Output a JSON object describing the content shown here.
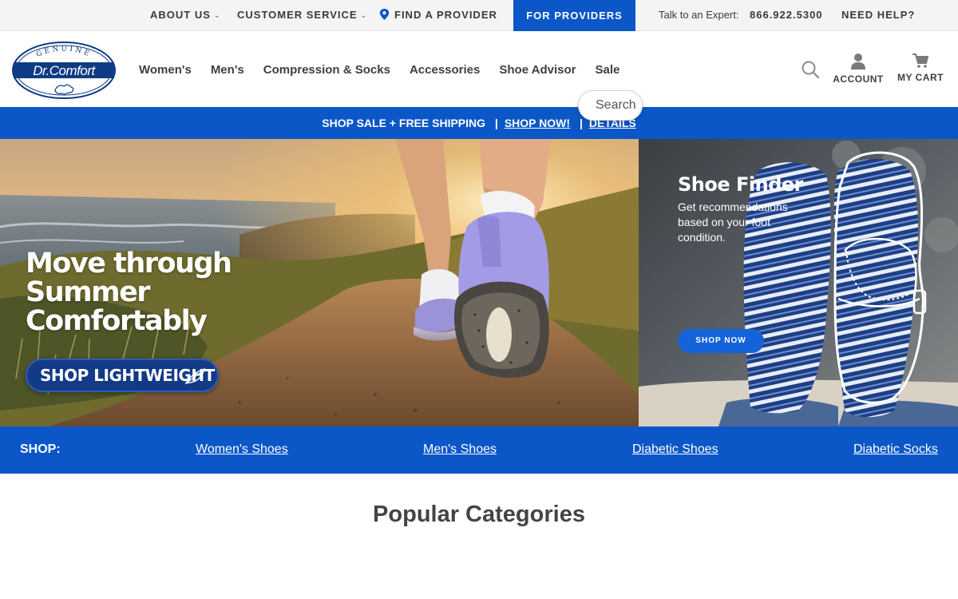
{
  "utility": {
    "about": "ABOUT US",
    "service": "CUSTOMER SERVICE",
    "provider": "FIND A PROVIDER",
    "for_providers": "FOR PROVIDERS",
    "expert_label": "Talk to an Expert:",
    "phone": "866.922.5300",
    "help": "NEED HELP?"
  },
  "logo": {
    "genuine": "GENUINE",
    "brand": "Dr.Comfort"
  },
  "nav": {
    "items": [
      "Women's",
      "Men's",
      "Compression & Socks",
      "Accessories",
      "Shoe Advisor",
      "Sale"
    ]
  },
  "header": {
    "account": "ACCOUNT",
    "cart": "MY CART"
  },
  "search": {
    "placeholder": "Search"
  },
  "promo": {
    "text": "SHOP SALE + FREE SHIPPING",
    "shop_now": "SHOP NOW!",
    "details": "DETAILS"
  },
  "hero": {
    "headline": [
      "Move through",
      "Summer",
      "Comfortably"
    ],
    "cta": "SHOP LIGHTWEIGHT"
  },
  "shoe_finder": {
    "title": "Shoe Finder",
    "description": "Get recommendations based on your foot condition.",
    "cta": "SHOP NOW"
  },
  "shop_bar": {
    "label": "SHOP:",
    "links": [
      "Women's Shoes",
      "Men's Shoes",
      "Diabetic Shoes",
      "Diabetic Socks"
    ]
  },
  "popular": {
    "title": "Popular Categories"
  },
  "colors": {
    "brand_blue": "#0c57c7",
    "navy": "#123a86",
    "logo_navy": "#0f3b84"
  }
}
